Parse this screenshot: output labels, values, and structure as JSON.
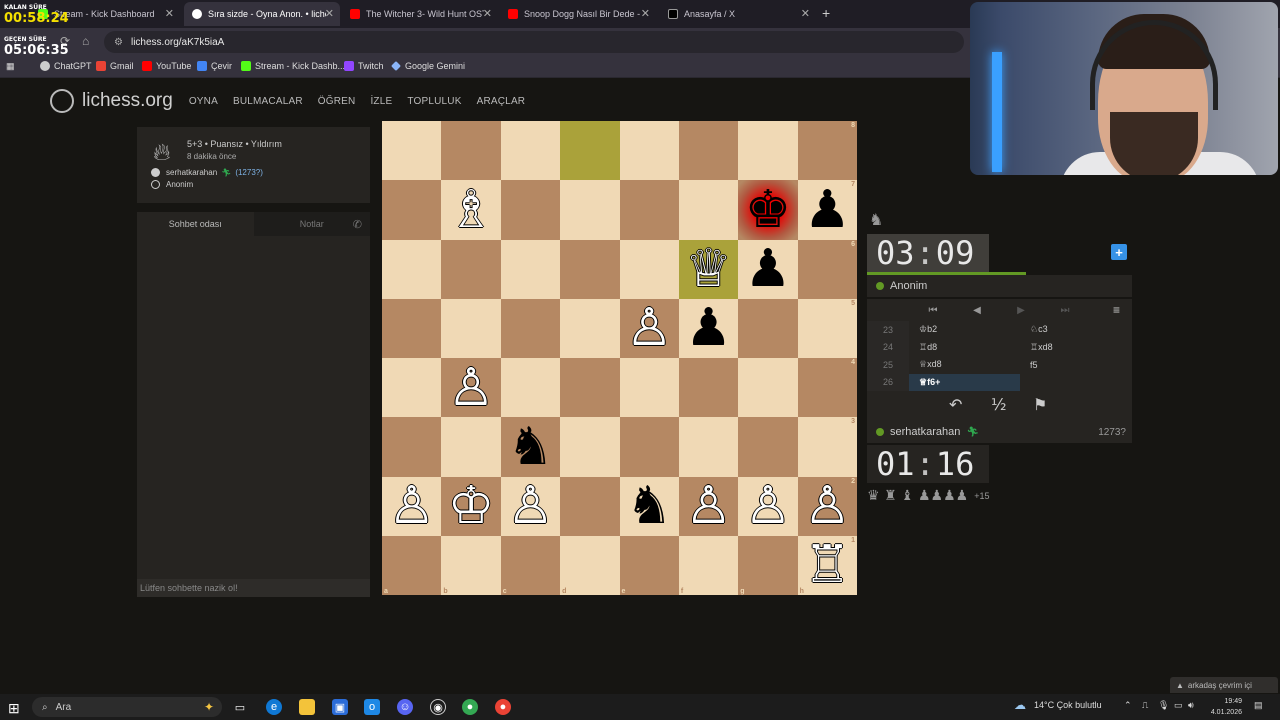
{
  "overlay": {
    "remaining_label": "KALAN SÜRE",
    "remaining_value": "00:58:24",
    "elapsed_label": "GEÇEN SÜRE",
    "elapsed_value": "05:06:35"
  },
  "browser": {
    "tabs": [
      {
        "label": "Stream - Kick Dashboard",
        "color": "#53fc18"
      },
      {
        "label": "Sıra sizde - Oyna Anon. • liches",
        "color": "#ffffff"
      },
      {
        "label": "The Witcher 3- Wild Hunt OST",
        "color": "#ff0000"
      },
      {
        "label": "Snoop Dogg Nasıl Bir Dede - Y",
        "color": "#ff0000"
      },
      {
        "label": "Anasayfa / X",
        "color": "#ffffff"
      }
    ],
    "url": "lichess.org/aK7k5iaA",
    "bookmarks": [
      {
        "label": "ChatGPT",
        "color": "#cccccc"
      },
      {
        "label": "Gmail",
        "color": "#ea4335"
      },
      {
        "label": "YouTube",
        "color": "#ff0000"
      },
      {
        "label": "Çevir",
        "color": "#4285f4"
      },
      {
        "label": "Stream - Kick Dashb...",
        "color": "#53fc18"
      },
      {
        "label": "Twitch",
        "color": "#9146ff"
      },
      {
        "label": "Google Gemini",
        "color": "#8ab4f8"
      }
    ]
  },
  "site": {
    "logo": "lichess.org",
    "nav": [
      "OYNA",
      "BULMACALAR",
      "ÖĞREN",
      "İZLE",
      "TOPLULUK",
      "ARAÇLAR"
    ]
  },
  "game": {
    "title": "5+3 • Puansız • Yıldırım",
    "time_ago": "8 dakika önce",
    "white_player": "serhatkarahan",
    "white_rating": "(1273?)",
    "black_player": "Anonim"
  },
  "chat": {
    "tab_room": "Sohbet odası",
    "tab_notes": "Notlar",
    "placeholder": "Lütfen sohbette nazik ol!"
  },
  "board": {
    "ranks": [
      "8",
      "7",
      "6",
      "5",
      "4",
      "3",
      "2",
      "1"
    ],
    "files": [
      "a",
      "b",
      "c",
      "d",
      "e",
      "f",
      "g",
      "h"
    ],
    "last_move_squares": [
      "d8",
      "f6"
    ],
    "check_square": "g7",
    "pieces": {
      "b7": "♗",
      "g7": "♚",
      "h7": "♟",
      "f6": "♕",
      "g6": "♟",
      "e5": "♙",
      "f5": "♟",
      "b4": "♙",
      "c3": "♞",
      "a2": "♙",
      "b2": "♔",
      "c2": "♙",
      "e2": "♞",
      "f2": "♙",
      "g2": "♙",
      "h2": "♙",
      "h1": "♖"
    }
  },
  "right": {
    "top_clock_min": "03",
    "top_clock_sec": "09",
    "top_clock_remaining_fraction": 0.6,
    "top_player": "Anonim",
    "bottom_player": "serhatkarahan",
    "bottom_rating": "1273?",
    "bottom_clock_min": "01",
    "bottom_clock_sec": "16",
    "moves": [
      {
        "n": "23",
        "w": "♔b2",
        "b": "♘c3"
      },
      {
        "n": "24",
        "w": "♖d8",
        "b": "♖xd8"
      },
      {
        "n": "25",
        "w": "♕xd8",
        "b": "f5"
      },
      {
        "n": "26",
        "w": "♕f6+",
        "b": ""
      }
    ],
    "draw_label": "½",
    "material_pieces": "♛ ♜ ♝ ♟♟♟♟",
    "material_adv": "+15"
  },
  "social": {
    "friends": "arkadaş çevrim içi"
  },
  "taskbar": {
    "search": "Ara",
    "weather": "14°C  Çok bulutlu",
    "time": "19:49",
    "date": "4.01.2026"
  }
}
